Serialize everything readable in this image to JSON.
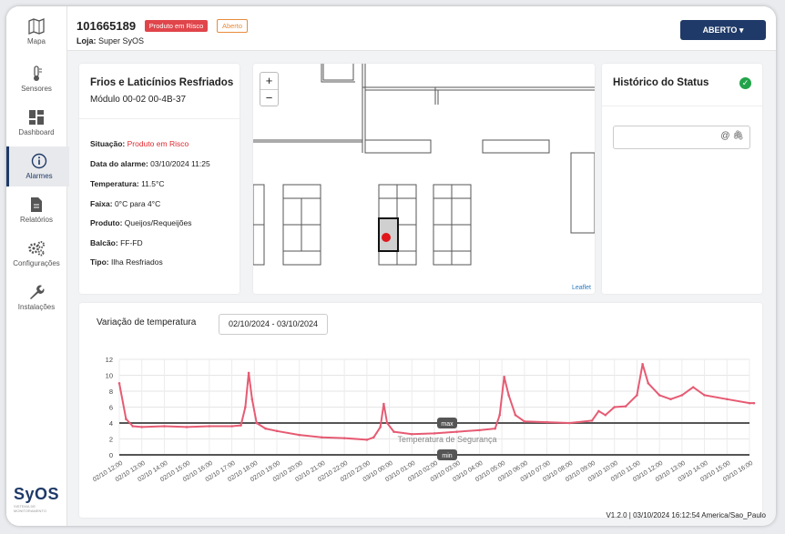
{
  "sidebar": {
    "items": [
      {
        "label": "Mapa",
        "icon": "map-icon"
      },
      {
        "label": "Sensores",
        "icon": "thermometer-icon"
      },
      {
        "label": "Dashboard",
        "icon": "dashboard-icon"
      },
      {
        "label": "Alarmes",
        "icon": "info-icon",
        "active": true
      },
      {
        "label": "Relatórios",
        "icon": "document-icon"
      },
      {
        "label": "Configurações",
        "icon": "gears-icon"
      },
      {
        "label": "Instalações",
        "icon": "wrench-icon"
      }
    ],
    "brand": "SyOS"
  },
  "header": {
    "id": "101665189",
    "badge_risk": "Produto em Risco",
    "badge_open": "Aberto",
    "loja_label": "Loja:",
    "loja_value": "Super SyOS",
    "status_button": "ABERTO ▾"
  },
  "info": {
    "title": "Frios e Laticínios Resfriados",
    "subtitle": "Módulo 00-02 00-4B-37",
    "rows": [
      {
        "label": "Situação:",
        "value": "Produto em Risco",
        "alert": true
      },
      {
        "label": "Data do alarme:",
        "value": "03/10/2024 11:25"
      },
      {
        "label": "Temperatura:",
        "value": "11.5°C"
      },
      {
        "label": "Faixa:",
        "value": "0°C para 4°C"
      },
      {
        "label": "Produto:",
        "value": "Queijos/Requeijões"
      },
      {
        "label": "Balcão:",
        "value": "FF-FD"
      },
      {
        "label": "Tipo:",
        "value": "Ilha Resfriados"
      }
    ]
  },
  "map": {
    "zoom_in": "+",
    "zoom_out": "−",
    "attribution": "Leaflet",
    "marker_color": "#e0161b"
  },
  "history": {
    "title": "Histórico do Status",
    "input_icons": "@ 🖇"
  },
  "chart_panel": {
    "title": "Variação de temperatura",
    "date_range": "02/10/2024 - 03/10/2024"
  },
  "chart_data": {
    "type": "line",
    "title": "",
    "ylim": [
      0,
      12
    ],
    "yticks": [
      0,
      2,
      4,
      6,
      8,
      10,
      12
    ],
    "xlabels": [
      "02/10 12:00",
      "02/10 13:00",
      "02/10 14:00",
      "02/10 15:00",
      "02/10 16:00",
      "02/10 17:00",
      "02/10 18:00",
      "02/10 19:00",
      "02/10 20:00",
      "02/10 21:00",
      "02/10 22:00",
      "02/10 23:00",
      "03/10 00:00",
      "03/10 01:00",
      "03/10 02:00",
      "03/10 03:00",
      "03/10 04:00",
      "03/10 05:00",
      "03/10 06:00",
      "03/10 07:00",
      "03/10 08:00",
      "03/10 09:00",
      "03/10 10:00",
      "03/10 11:00",
      "03/10 12:00",
      "03/10 13:00",
      "03/10 14:00",
      "03/10 15:00",
      "03/10 16:00"
    ],
    "series": [
      {
        "color": "#e65b73",
        "points": [
          [
            0,
            9
          ],
          [
            0.3,
            4.5
          ],
          [
            0.6,
            3.6
          ],
          [
            1,
            3.5
          ],
          [
            2,
            3.6
          ],
          [
            3,
            3.5
          ],
          [
            4,
            3.6
          ],
          [
            5,
            3.6
          ],
          [
            5.4,
            3.7
          ],
          [
            5.6,
            6
          ],
          [
            5.75,
            10.3
          ],
          [
            5.9,
            7
          ],
          [
            6.1,
            4
          ],
          [
            6.5,
            3.3
          ],
          [
            7,
            3
          ],
          [
            8,
            2.5
          ],
          [
            9,
            2.2
          ],
          [
            10,
            2.1
          ],
          [
            11,
            1.9
          ],
          [
            11.3,
            2.2
          ],
          [
            11.6,
            3.5
          ],
          [
            11.75,
            6.4
          ],
          [
            11.9,
            4
          ],
          [
            12.2,
            2.9
          ],
          [
            13,
            2.6
          ],
          [
            14,
            2.7
          ],
          [
            15,
            2.9
          ],
          [
            16,
            3.1
          ],
          [
            16.7,
            3.3
          ],
          [
            16.9,
            5
          ],
          [
            17.1,
            9.8
          ],
          [
            17.3,
            7.5
          ],
          [
            17.6,
            5
          ],
          [
            18,
            4.2
          ],
          [
            19,
            4.1
          ],
          [
            20,
            4
          ],
          [
            21,
            4.3
          ],
          [
            21.3,
            5.5
          ],
          [
            21.6,
            5
          ],
          [
            22,
            6
          ],
          [
            22.5,
            6.1
          ],
          [
            23,
            7.5
          ],
          [
            23.25,
            11.4
          ],
          [
            23.5,
            9
          ],
          [
            24,
            7.5
          ],
          [
            24.5,
            7
          ],
          [
            25,
            7.5
          ],
          [
            25.5,
            8.5
          ],
          [
            26,
            7.5
          ],
          [
            27,
            7
          ],
          [
            28,
            6.5
          ],
          [
            28.2,
            6.5
          ]
        ]
      }
    ],
    "limits": [
      {
        "label": "max",
        "value": 4
      },
      {
        "label": "min",
        "value": 0
      }
    ],
    "annotation": "Temperatura de Segurança",
    "grid": true
  },
  "footer": {
    "text": "V1.2.0 | 03/10/2024 16:12:54 America/Sao_Paulo"
  }
}
